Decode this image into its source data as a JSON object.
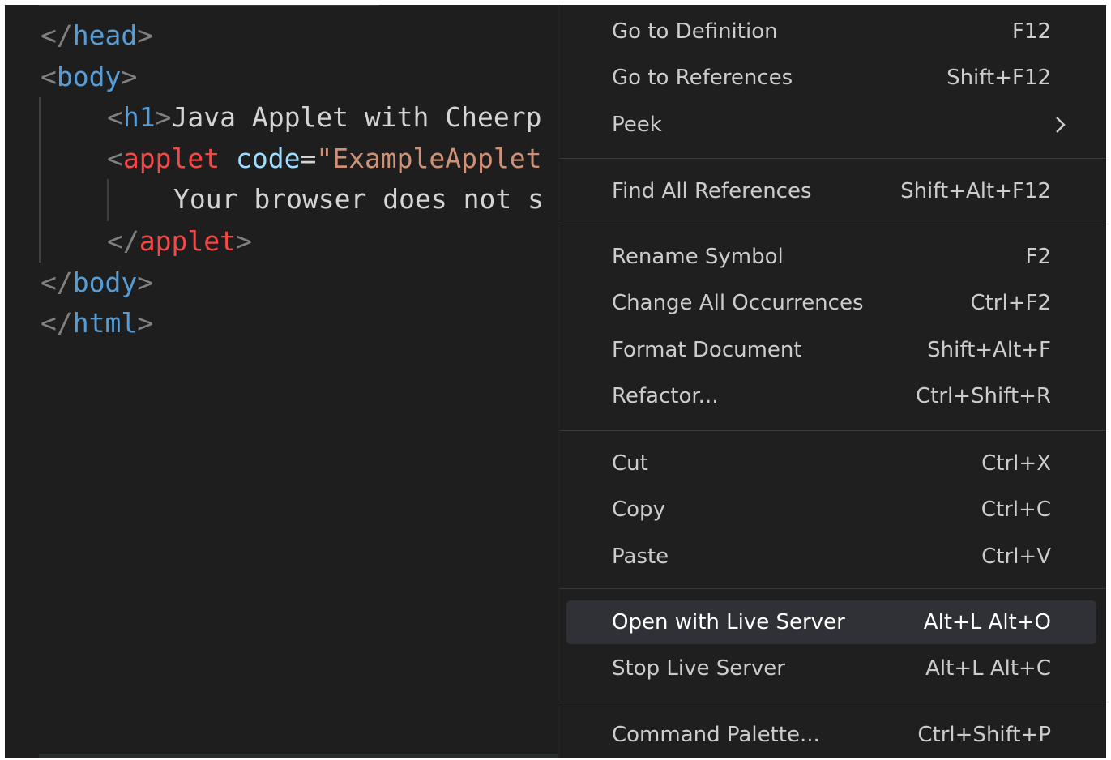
{
  "editor": {
    "lines": {
      "line1": {
        "open": "</",
        "tag": "head",
        "close": ">"
      },
      "line2": {
        "open": "<",
        "tag": "body",
        "close": ">"
      },
      "line3": {
        "open": "<",
        "tag": "h1",
        "close": ">",
        "text": "Java Applet with Cheerp"
      },
      "line4": {
        "open": "<",
        "tag": "applet",
        "space": " ",
        "attr": "code",
        "eq": "=",
        "str": "\"ExampleApplet"
      },
      "line5": {
        "text": "Your browser does not s"
      },
      "line6": {
        "open": "</",
        "tag": "applet",
        "close": ">"
      },
      "line7": {
        "open": "</",
        "tag": "body",
        "close": ">"
      },
      "line8": {
        "open": "</",
        "tag": "html",
        "close": ">"
      }
    }
  },
  "menu": {
    "items": [
      {
        "label": "Go to Definition",
        "shortcut": "F12"
      },
      {
        "label": "Go to References",
        "shortcut": "Shift+F12"
      },
      {
        "label": "Peek",
        "shortcut": ""
      },
      {
        "label": "Find All References",
        "shortcut": "Shift+Alt+F12"
      },
      {
        "label": "Rename Symbol",
        "shortcut": "F2"
      },
      {
        "label": "Change All Occurrences",
        "shortcut": "Ctrl+F2"
      },
      {
        "label": "Format Document",
        "shortcut": "Shift+Alt+F"
      },
      {
        "label": "Refactor...",
        "shortcut": "Ctrl+Shift+R"
      },
      {
        "label": "Cut",
        "shortcut": "Ctrl+X"
      },
      {
        "label": "Copy",
        "shortcut": "Ctrl+C"
      },
      {
        "label": "Paste",
        "shortcut": "Ctrl+V"
      },
      {
        "label": "Open with Live Server",
        "shortcut": "Alt+L Alt+O"
      },
      {
        "label": "Stop Live Server",
        "shortcut": "Alt+L Alt+C"
      },
      {
        "label": "Command Palette...",
        "shortcut": "Ctrl+Shift+P"
      }
    ],
    "active_item": "Open with Live Server",
    "submenu_icon": "chevron-right-icon"
  },
  "colors": {
    "background": "#1e1e1e",
    "menu_background": "#1f1f1f",
    "menu_hover": "#2f3136",
    "tag": "#569cd6",
    "tag_applet": "#f44747",
    "attribute": "#9cdcfe",
    "string": "#ce9178",
    "punctuation": "#808080",
    "text": "#d4d4d4"
  }
}
